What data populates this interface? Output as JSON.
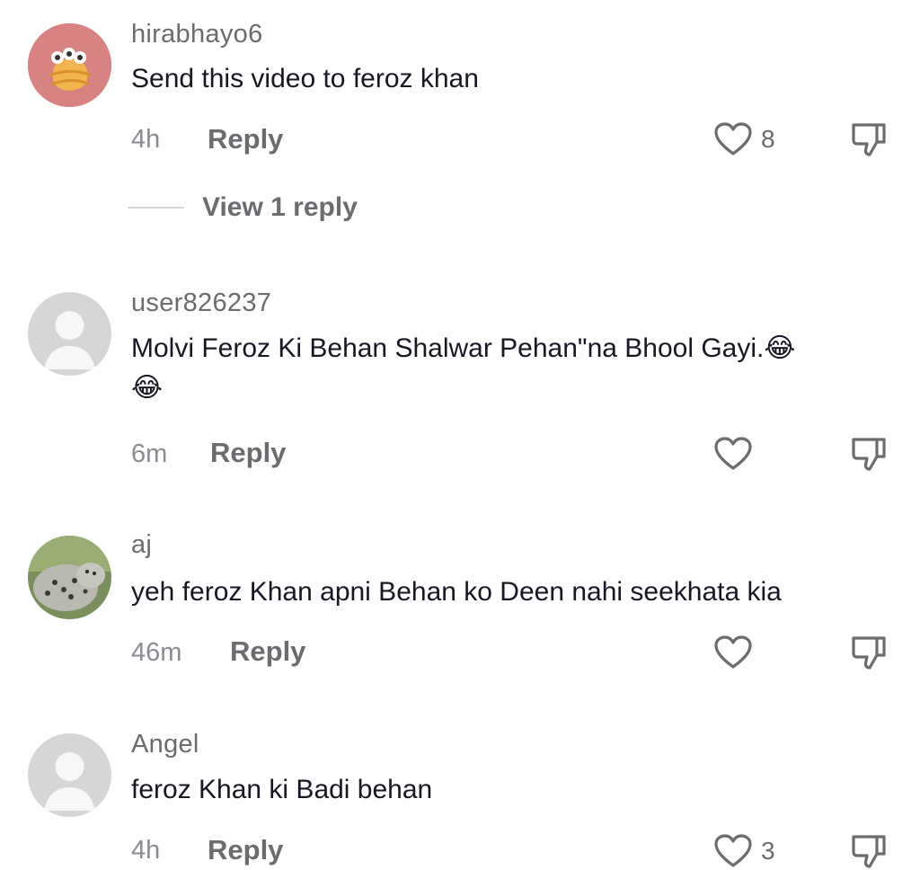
{
  "comments": [
    {
      "username": "hirabhayo6",
      "text": "Send this video to feroz khan",
      "time": "4h",
      "reply_label": "Reply",
      "like_count": "8",
      "view_replies": "View 1 reply"
    },
    {
      "username": "user826237",
      "text_line1": "Molvi Feroz Ki Behan Shalwar Pehan\"na Bhool Gayi.😂",
      "text_line2": "😂",
      "time": "6m",
      "reply_label": "Reply"
    },
    {
      "username": "aj",
      "text": "yeh feroz Khan apni Behan ko Deen nahi seekhata kia",
      "time": "46m",
      "reply_label": "Reply"
    },
    {
      "username": "Angel",
      "text": "feroz Khan ki Badi behan",
      "time": "4h",
      "reply_label": "Reply",
      "like_count": "3"
    }
  ],
  "colors": {
    "username": "#6b6b70",
    "text": "#161823",
    "meta": "#8a8b91",
    "default_avatar_bg": "#d6d6d9",
    "default_avatar_fg": "#f7f7f8",
    "avatar1_bg": "#d98282"
  },
  "icons": {
    "like": "heart-outline-icon",
    "dislike": "thumbs-down-outline-icon"
  }
}
